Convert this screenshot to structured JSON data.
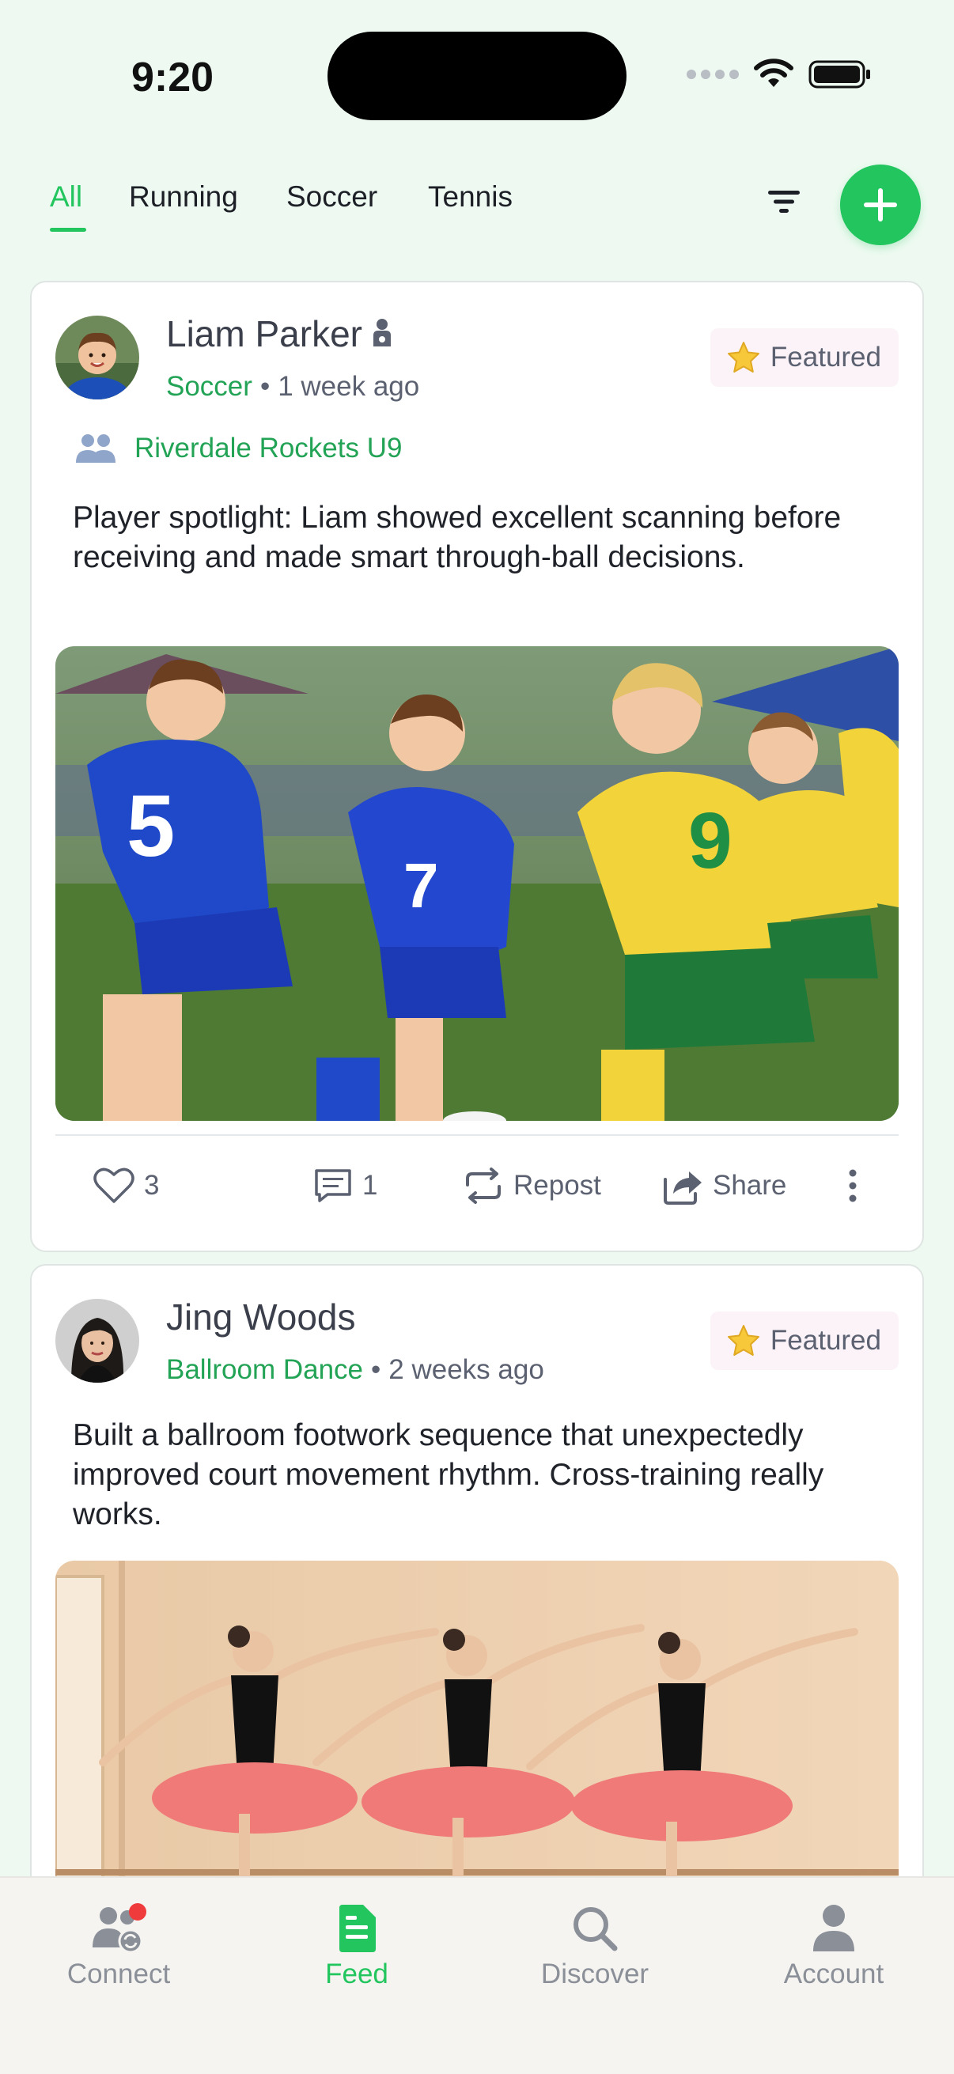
{
  "status_bar": {
    "time": "9:20"
  },
  "tabs": [
    {
      "label": "All",
      "active": true
    },
    {
      "label": "Running",
      "active": false
    },
    {
      "label": "Soccer",
      "active": false
    },
    {
      "label": "Tennis",
      "active": false
    }
  ],
  "actions": {
    "filter_icon": "filter-icon",
    "add_icon": "plus-icon"
  },
  "posts": [
    {
      "author": "Liam Parker",
      "author_badge_icon": "child-athlete-icon",
      "sport": "Soccer",
      "time": "1 week ago",
      "featured_label": "Featured",
      "team": "Riverdale Rockets U9",
      "text": "Player spotlight: Liam showed excellent scanning before receiving and made smart through-ball decisions.",
      "likes": "3",
      "comments": "1",
      "repost_label": "Repost",
      "share_label": "Share"
    },
    {
      "author": "Jing Woods",
      "sport": "Ballroom Dance",
      "time": "2 weeks ago",
      "featured_label": "Featured",
      "text": "Built a ballroom footwork sequence that unexpectedly improved court movement rhythm. Cross-training really works."
    }
  ],
  "bottom_nav": [
    {
      "label": "Connect",
      "icon": "connect-icon",
      "active": false,
      "has_notification": true
    },
    {
      "label": "Feed",
      "icon": "feed-icon",
      "active": true
    },
    {
      "label": "Discover",
      "icon": "search-icon",
      "active": false
    },
    {
      "label": "Account",
      "icon": "person-icon",
      "active": false
    }
  ],
  "colors": {
    "accent": "#22c55e",
    "background": "#eefaf1",
    "featured_bg": "#fbf3f8",
    "notification": "#ef3b3b"
  }
}
